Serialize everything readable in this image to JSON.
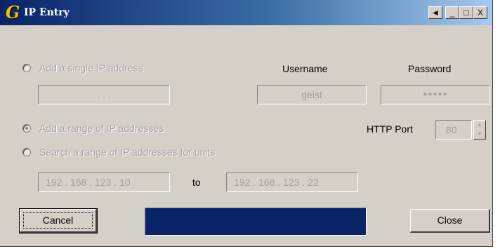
{
  "window": {
    "title": "IP Entry",
    "app_icon_glyph": "G",
    "controls": {
      "minimize": "_",
      "maximize": "□",
      "close": "X",
      "extra": "◄"
    }
  },
  "options": {
    "single_ip": {
      "label": "Add a single IP address",
      "selected": false,
      "value": ".       .       ."
    },
    "range": {
      "label": "Add a range of IP addresses",
      "selected": true
    },
    "search": {
      "label": "Search a range of IP addresses for units",
      "selected": false
    }
  },
  "credentials": {
    "username_label": "Username",
    "username_value": "geist",
    "password_label": "Password",
    "password_value": "●●●●●"
  },
  "http_port": {
    "label": "HTTP Port",
    "value": "80"
  },
  "range": {
    "from": "192 . 168 . 123 .  10",
    "to_label": "to",
    "to": "192 . 168 . 123 .  22"
  },
  "buttons": {
    "cancel": "Cancel",
    "close": "Close"
  },
  "progress": {
    "fraction": 1.0,
    "color": "#0a246a"
  }
}
